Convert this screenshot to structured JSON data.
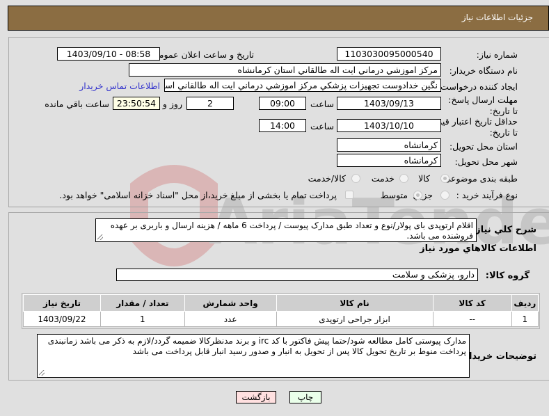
{
  "header": {
    "title": "جزئيات اطلاعات نياز"
  },
  "form": {
    "need_number": {
      "label": "شماره نياز:",
      "value": "1103030095000540"
    },
    "announce_datetime": {
      "label": "تاريخ و ساعت اعلان عمومي:",
      "value": "1403/09/10 - 08:58"
    },
    "buyer_org": {
      "label": "نام دستگاه خريدار:",
      "value": "مرکز اموزشي درماني ايت اله طالقاني استان کرمانشاه"
    },
    "requester": {
      "label": "ايجاد کننده درخواست:",
      "value": "نگين خدادوست تجهيزات پزشکي مرکز اموزشي درماني ايت اله طالقاني استان",
      "contact_link": "اطلاعات تماس خريدار"
    },
    "reply_deadline": {
      "label": "مهلت ارسال پاسخ: تا تاريخ:",
      "date": "1403/09/13",
      "time_label": "ساعت",
      "time": "09:00",
      "days": "2",
      "days_label": "روز و",
      "remaining": "23:50:54",
      "remaining_label": "ساعت باقي مانده"
    },
    "price_validity": {
      "label": "حداقل تاريخ اعتبار قيمت: تا تاريخ:",
      "date": "1403/10/10",
      "time_label": "ساعت",
      "time": "14:00"
    },
    "delivery_province": {
      "label": "استان محل تحويل:",
      "value": "کرمانشاه"
    },
    "delivery_city": {
      "label": "شهر محل تحويل:",
      "value": "کرمانشاه"
    },
    "category": {
      "label": "طبقه بندی موضوعی:",
      "options": [
        "کالا",
        "خدمت",
        "کالا/خدمت"
      ],
      "selected": "کالا"
    },
    "purchase_type": {
      "label": "نوع فرآيند خريد :",
      "options": [
        "جزيي",
        "متوسط"
      ],
      "selected": "متوسط",
      "treasury_checkbox_label": "پرداخت تمام یا بخشی از مبلغ خرید،از محل \"اسناد خزانه اسلامی\" خواهد بود.",
      "treasury_checked": false
    }
  },
  "details": {
    "description_label": "شرح کلي نياز:",
    "description": "اقلام ارتوپدی بای پولار/نوع و تعداد طبق مدارک پیوست / پرداخت 6 ماهه / هزینه ارسال و باربری بر عهده فروشنده می باشد.",
    "items_section_title": "اطلاعات کالاهاي مورد نياز",
    "goods_group_label": "گروه کالا:",
    "goods_group": "دارو، پزشکی و سلامت",
    "table": {
      "columns": [
        "رديف",
        "کد کالا",
        "نام کالا",
        "واحد شمارش",
        "تعداد / مقدار",
        "تاريخ نياز"
      ],
      "rows": [
        [
          "1",
          "--",
          "ابزار جراحی ارتوپدی",
          "عدد",
          "1",
          "1403/09/22"
        ]
      ]
    },
    "buyer_notes_label": "توضيحات خريدار:",
    "buyer_notes": "مدارک پیوستی کامل مطالعه شود/حتما پیش فاکتور با کد irc و برند مدنظرکالا ضمیمه گردد/لازم به ذکر می باشد زمانبندی پرداخت منوط بر تاریخ تحویل کالا  پس از تحویل به انبار و صدور رسید انبار قابل پرداخت می باشد"
  },
  "buttons": {
    "print": "چاپ",
    "back": "بازگشت"
  },
  "colors": {
    "header_bg": "#8b6d42",
    "print_bg": "#eaffea",
    "back_bg": "#ffe0e0",
    "link": "#3333cc"
  }
}
